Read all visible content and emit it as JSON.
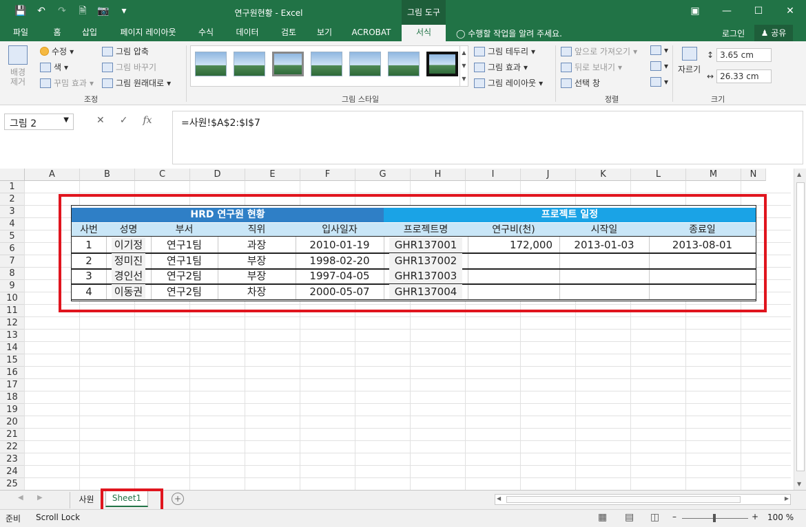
{
  "window": {
    "title": "연구원현황 - Excel",
    "context_tab": "그림 도구"
  },
  "tabs": [
    "파일",
    "홈",
    "삽입",
    "페이지 레이아웃",
    "수식",
    "데이터",
    "검토",
    "보기",
    "ACROBAT",
    "서식"
  ],
  "tell_me": "수행할 작업을 알려 주세요.",
  "login": "로그인",
  "share": "공유",
  "ribbon": {
    "remove_bg": "배경 제거",
    "corrections": "수정",
    "color": "색",
    "art_effects": "꾸밈 효과",
    "compress": "그림 압축",
    "change": "그림 바꾸기",
    "reset": "그림 원래대로",
    "adjust_label": "조정",
    "styles_label": "그림 스타일",
    "border": "그림 테두리",
    "effects": "그림 효과",
    "layout": "그림 레이아웃",
    "bring_forward": "앞으로 가져오기",
    "send_backward": "뒤로 보내기",
    "selection_pane": "선택 창",
    "arrange_label": "정렬",
    "crop": "자르기",
    "height": "3.65 cm",
    "width": "26.33 cm",
    "size_label": "크기"
  },
  "name_box": "그림 2",
  "formula": "=사원!$A$2:$I$7",
  "columns": [
    "A",
    "B",
    "C",
    "D",
    "E",
    "F",
    "G",
    "H",
    "I",
    "J",
    "K",
    "L",
    "M",
    "N"
  ],
  "rows": [
    "1",
    "2",
    "3",
    "4",
    "5",
    "6",
    "7",
    "8",
    "9",
    "10",
    "11",
    "12",
    "13",
    "14",
    "15",
    "16",
    "17",
    "18",
    "19",
    "20",
    "21",
    "22",
    "23",
    "24",
    "25"
  ],
  "table": {
    "left_title": "HRD 연구원 현황",
    "right_title": "프로젝트 일정",
    "headers": [
      "사번",
      "성명",
      "부서",
      "직위",
      "입사일자",
      "프로젝트명",
      "연구비(천)",
      "시작일",
      "종료일"
    ],
    "rows": [
      [
        "1",
        "이기정",
        "연구1팀",
        "과장",
        "2010-01-19",
        "GHR137001",
        "172,000",
        "2013-01-03",
        "2013-08-01"
      ],
      [
        "2",
        "정미진",
        "연구1팀",
        "부장",
        "1998-02-20",
        "GHR137002",
        "",
        "",
        ""
      ],
      [
        "3",
        "경인선",
        "연구2팀",
        "부장",
        "1997-04-05",
        "GHR137003",
        "",
        "",
        ""
      ],
      [
        "4",
        "이동권",
        "연구2팀",
        "차장",
        "2000-05-07",
        "GHR137004",
        "",
        "",
        ""
      ]
    ],
    "left_color": "#2f7fc6",
    "right_color": "#1aa3e6"
  },
  "sheets": [
    "사원",
    "Sheet1"
  ],
  "status": {
    "ready": "준비",
    "scroll_lock": "Scroll Lock",
    "zoom": "100 %"
  }
}
